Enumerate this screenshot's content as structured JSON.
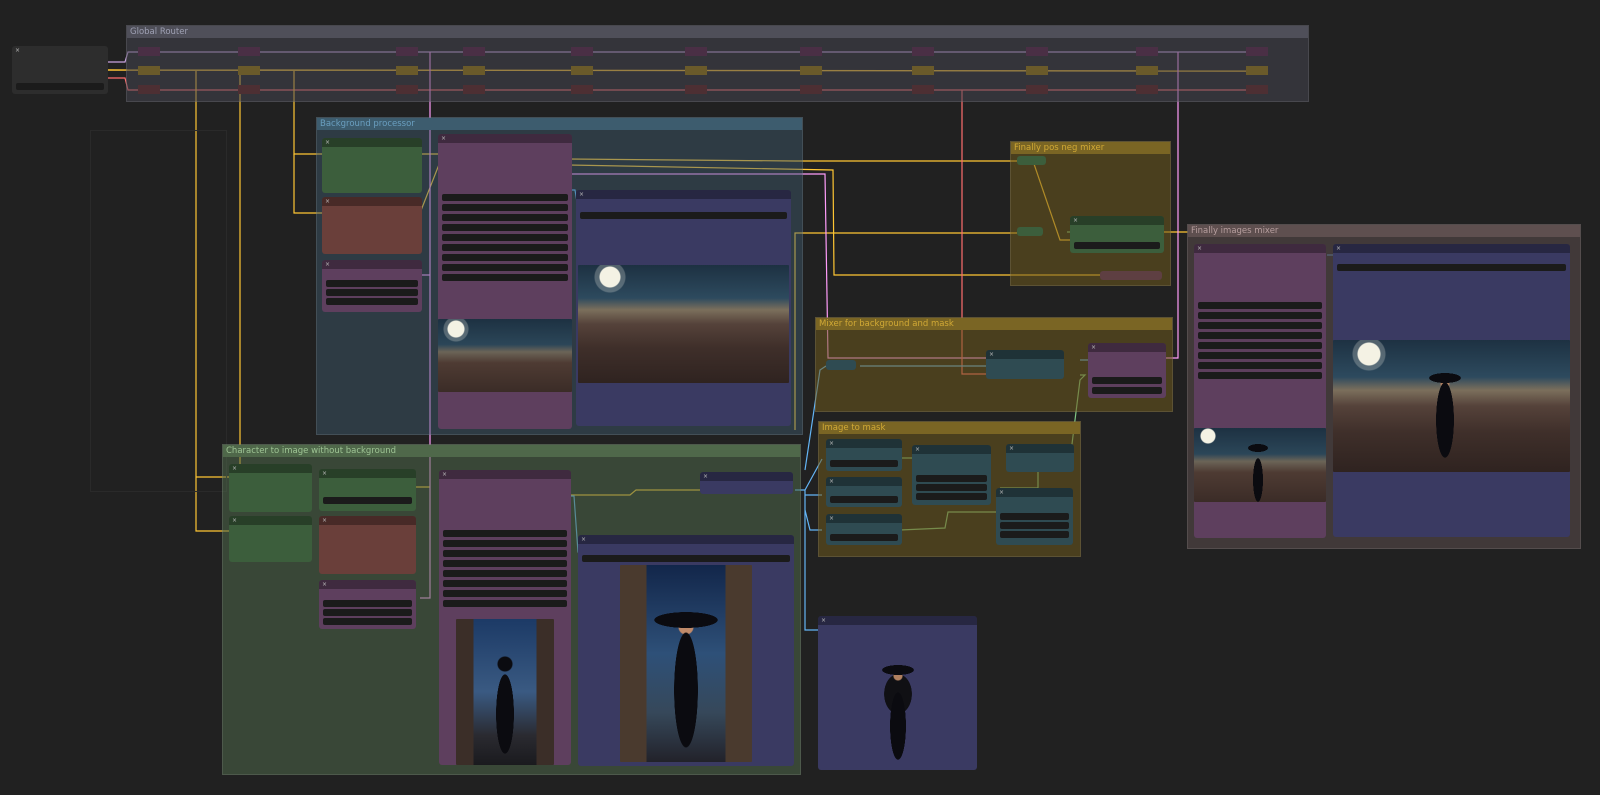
{
  "app": {
    "name": "ComfyUI workflow canvas"
  },
  "colors": {
    "canvas_bg": "#212121",
    "wire_latent": "#ff9cf9",
    "wire_clip": "#ffd500",
    "wire_vae": "#ff6e6e",
    "wire_image": "#64b5f6",
    "wire_mask": "#81c784",
    "node_green": "#335533",
    "node_brown": "#553333",
    "node_purple": "#553355",
    "node_blue": "#333355",
    "node_teal": "#2f4b52"
  },
  "groups": {
    "global_router": "Global Router",
    "background_processor": "Background processor",
    "character": "Character to image without background",
    "mixer_bg_mask": "Mixer for background and mask",
    "image_to_mask": "Image to mask",
    "pos_neg_mixer": "Finally pos neg mixer",
    "images_mixer": "Finally images mixer"
  },
  "icons": {
    "node_close": "×",
    "image_moon_rooftops": "night-rooftops-moon-image",
    "image_witch_street": "witch-in-alley-image",
    "image_witch_cutout": "witch-no-background-image",
    "image_composite": "witch-on-rooftops-image"
  }
}
